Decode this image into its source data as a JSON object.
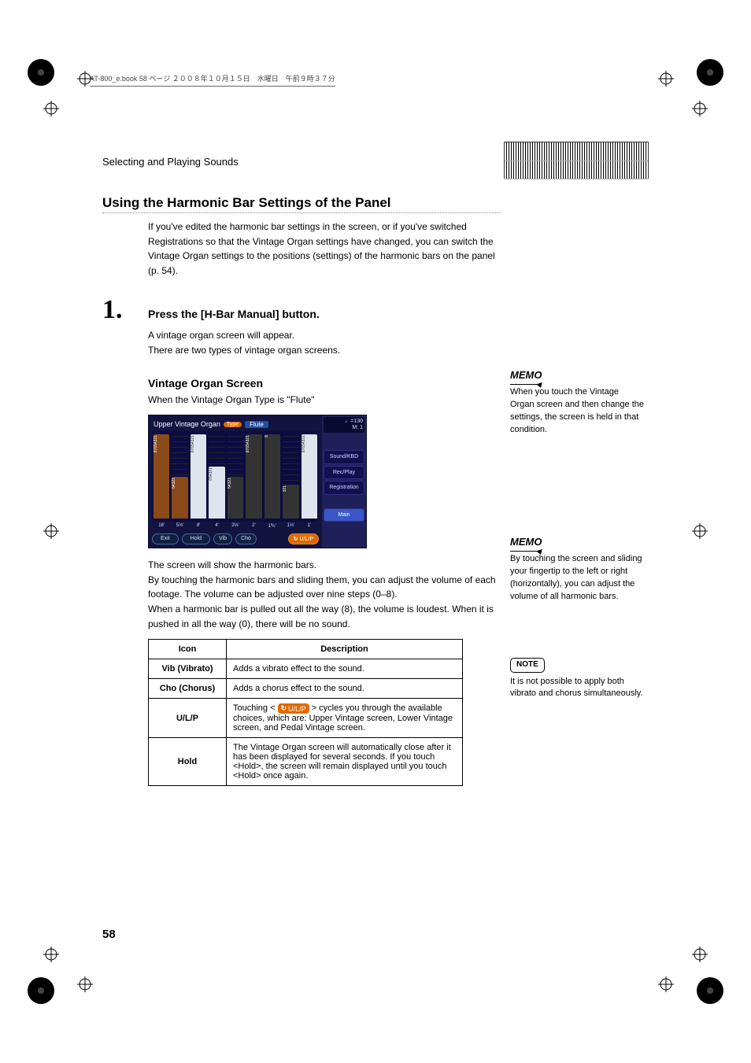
{
  "header_strip": "AT-800_e.book  58 ページ  ２００８年１０月１５日　水曜日　午前９時３７分",
  "breadcrumb": "Selecting and Playing Sounds",
  "section": {
    "title": "Using the Harmonic Bar Settings of the Panel",
    "intro": "If you've edited the harmonic bar settings in the screen, or if you've switched Registrations so that the Vintage Organ settings have changed, you can switch the Vintage Organ settings to the positions (settings) of the harmonic bars on the panel (p. 54)."
  },
  "step1": {
    "number": "1.",
    "title": "Press the [H-Bar Manual] button.",
    "line1": "A vintage organ screen will appear.",
    "line2": "There are two types of vintage organ screens."
  },
  "subheading": "Vintage Organ Screen",
  "subheading_caption": "When the Vintage Organ Type is \"Flute\"",
  "screen": {
    "header_left": "Upper Vintage Organ",
    "type_badge": "Type",
    "type_value": "Flute",
    "tempo": "♩=130",
    "measure": "M:      1",
    "side": {
      "sound": "Sound/KBD",
      "rec": "Rec/Play",
      "registration": "Registration",
      "main": "Main"
    },
    "footages": [
      "16'",
      "5⅓'",
      "8'",
      "4'",
      "2⅔'",
      "2'",
      "1⅗'",
      "1⅓'",
      "1'"
    ],
    "buttons": {
      "exit": "Exit",
      "hold": "Hold",
      "vib": "Vib",
      "cho": "Cho",
      "ulp": "U/L/P"
    }
  },
  "post_screen": {
    "p1": "The screen will show the harmonic bars.",
    "p2": "By touching the harmonic bars and sliding them, you can adjust the volume of each footage. The volume can be adjusted over nine steps (0–8).",
    "p3": "When a harmonic bar is pulled out all the way (8), the volume is loudest. When it is pushed in all the way (0), there will be no sound."
  },
  "table": {
    "headers": {
      "icon": "Icon",
      "desc": "Description"
    },
    "rows": {
      "vib": {
        "icon": "Vib (Vibrato)",
        "desc": "Adds a vibrato effect to the sound."
      },
      "cho": {
        "icon": "Cho (Chorus)",
        "desc": "Adds a chorus effect to the sound."
      },
      "ulp": {
        "icon": "U/L/P",
        "desc_pre": "Touching < ",
        "desc_chip": "U/L/P",
        "desc_post": " > cycles you through the available choices, which are: Upper Vintage screen, Lower Vintage screen, and Pedal Vintage screen."
      },
      "hold": {
        "icon": "Hold",
        "desc": "The Vintage Organ screen will automatically close after it has been displayed for several seconds. If you touch <Hold>, the screen will remain displayed until you touch <Hold> once again."
      }
    }
  },
  "notes": {
    "memo_label": "MEMO",
    "note_label": "NOTE",
    "memo1": "When you touch the Vintage Organ screen and then change the settings, the screen is held in that condition.",
    "memo2": "By touching the screen and sliding your fingertip to the left or right (horizontally), you can adjust the volume of all harmonic bars.",
    "note1": "It is not possible to apply both vibrato and chorus simultaneously."
  },
  "page_number": "58"
}
